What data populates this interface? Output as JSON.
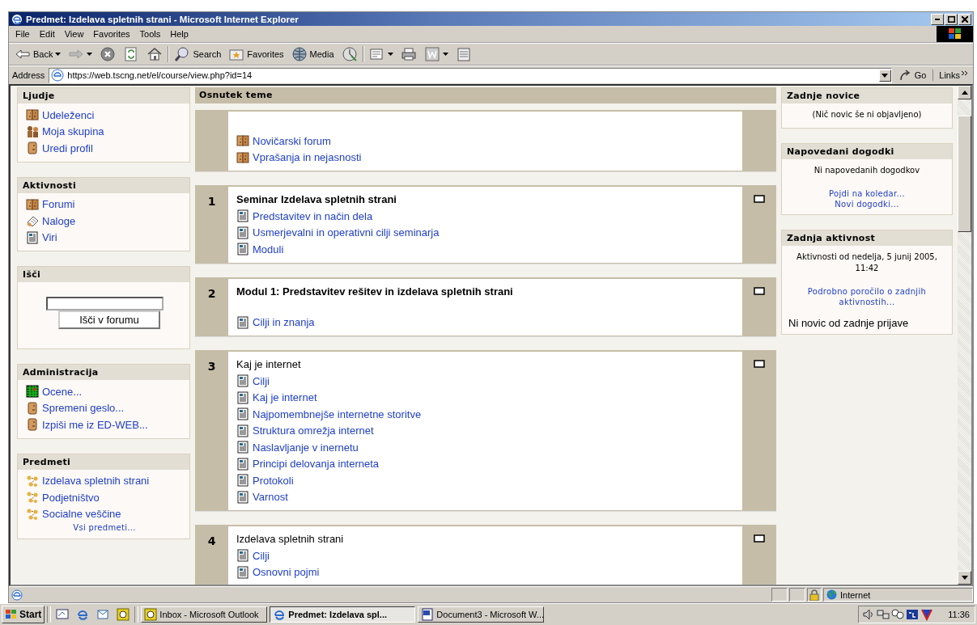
{
  "window": {
    "title": "Predmet: Izdelava spletnih strani - Microsoft Internet Explorer"
  },
  "menu": [
    "File",
    "Edit",
    "View",
    "Favorites",
    "Tools",
    "Help"
  ],
  "toolbar": [
    {
      "kind": "back",
      "label": "Back",
      "dropdown": true
    },
    {
      "kind": "forward",
      "dropdown": true
    },
    {
      "kind": "stop",
      "dropdown": false
    },
    {
      "kind": "refresh",
      "dropdown": false
    },
    {
      "kind": "home",
      "dropdown": false
    },
    {
      "kind": "search",
      "label": "Search",
      "dropdown": false
    },
    {
      "kind": "favorites",
      "label": "Favorites",
      "dropdown": false
    },
    {
      "kind": "media",
      "label": "Media",
      "dropdown": false
    },
    {
      "kind": "history",
      "dropdown": false
    },
    {
      "kind": "mail",
      "dropdown": true
    },
    {
      "kind": "print",
      "dropdown": false
    },
    {
      "kind": "edit",
      "dropdown": true
    },
    {
      "kind": "discuss",
      "dropdown": false
    }
  ],
  "address": {
    "label": "Address",
    "value": "https://web.tscng.net/el/course/view.php?id=14",
    "go": "Go",
    "links": "Links"
  },
  "left_blocks": [
    {
      "title": "Ljudje",
      "items": [
        {
          "kind": "forum",
          "text": "Udeleženci"
        },
        {
          "kind": "group",
          "text": "Moja skupina"
        },
        {
          "kind": "person",
          "text": "Uredi profil"
        }
      ]
    },
    {
      "title": "Aktivnosti",
      "items": [
        {
          "kind": "forum",
          "text": "Forumi"
        },
        {
          "kind": "assignment",
          "text": "Naloge"
        },
        {
          "kind": "resource",
          "text": "Viri"
        }
      ]
    },
    {
      "title": "Išči",
      "search": {
        "button": "Išči v forumu"
      }
    },
    {
      "title": "Administracija",
      "items": [
        {
          "kind": "grades",
          "text": "Ocene..."
        },
        {
          "kind": "person",
          "text": "Spremeni geslo..."
        },
        {
          "kind": "person",
          "text": "Izpiši me iz ED-WEB..."
        }
      ]
    },
    {
      "title": "Predmeti",
      "items": [
        {
          "kind": "course",
          "text": "Izdelava spletnih strani"
        },
        {
          "kind": "course",
          "text": "Podjetništvo"
        },
        {
          "kind": "course",
          "text": "Socialne veščine"
        }
      ],
      "footer": "Vsi predmeti..."
    }
  ],
  "main": {
    "title": "Osnutek teme",
    "sections": [
      {
        "links": [
          {
            "kind": "forum",
            "text": "Novičarski forum"
          },
          {
            "kind": "forum",
            "text": "Vprašanja in nejasnosti"
          }
        ]
      },
      {
        "number": "1",
        "title": "Seminar Izdelava spletnih strani",
        "bold": true,
        "links": [
          {
            "kind": "resource",
            "text": "Predstavitev in način dela"
          },
          {
            "kind": "resource",
            "text": "Usmerjevalni in operativni cilji seminarja"
          },
          {
            "kind": "resource",
            "text": "Moduli"
          }
        ]
      },
      {
        "number": "2",
        "title": "Modul 1: Predstavitev rešitev in izdelava spletnih strani",
        "bold": true,
        "gap": true,
        "links": [
          {
            "kind": "resource",
            "text": "Cilji in znanja"
          }
        ]
      },
      {
        "number": "3",
        "title": "Kaj je internet",
        "bold": false,
        "links": [
          {
            "kind": "resource",
            "text": "Cilji"
          },
          {
            "kind": "resource",
            "text": "Kaj je internet"
          },
          {
            "kind": "resource",
            "text": "Najpomembnejše internetne storitve"
          },
          {
            "kind": "resource",
            "text": "Struktura omrežja internet"
          },
          {
            "kind": "resource",
            "text": "Naslavljanje v inernetu"
          },
          {
            "kind": "resource",
            "text": "Principi delovanja interneta"
          },
          {
            "kind": "resource",
            "text": "Protokoli"
          },
          {
            "kind": "resource",
            "text": "Varnost"
          }
        ]
      },
      {
        "number": "4",
        "title": "Izdelava spletnih strani",
        "bold": false,
        "links": [
          {
            "kind": "resource",
            "text": "Cilji"
          },
          {
            "kind": "resource",
            "text": "Osnovni pojmi"
          }
        ]
      }
    ]
  },
  "right_blocks": [
    {
      "title": "Zadnje novice",
      "items": [
        {
          "kind": "text",
          "text": "(Nič novic še ni objavljeno)"
        }
      ]
    },
    {
      "title": "Napovedani dogodki",
      "items": [
        {
          "kind": "text",
          "text": "Ni napovedanih dogodkov"
        },
        {
          "kind": "link",
          "text": "Pojdi na koledar..."
        },
        {
          "kind": "link",
          "text": "Novi dogodki..."
        }
      ]
    },
    {
      "title": "Zadnja aktivnost",
      "items": [
        {
          "kind": "text",
          "text": "Aktivnosti od nedelja, 5 junij 2005, 11:42"
        },
        {
          "kind": "link",
          "text": "Podrobno poročilo o zadnjih aktivnostih..."
        },
        {
          "kind": "note",
          "text": "Ni novic od zadnje prijave"
        }
      ]
    }
  ],
  "status_bar": {
    "zone": "Internet"
  },
  "taskbar": {
    "start": "Start",
    "tasks": [
      {
        "text": "Inbox - Microsoft Outlook",
        "kind": "outlook",
        "selected": false
      },
      {
        "text": "Predmet: Izdelava spl...",
        "kind": "ie",
        "selected": true
      },
      {
        "text": "Document3 - Microsoft W...",
        "kind": "word",
        "selected": false
      }
    ],
    "clock": "11:36"
  }
}
